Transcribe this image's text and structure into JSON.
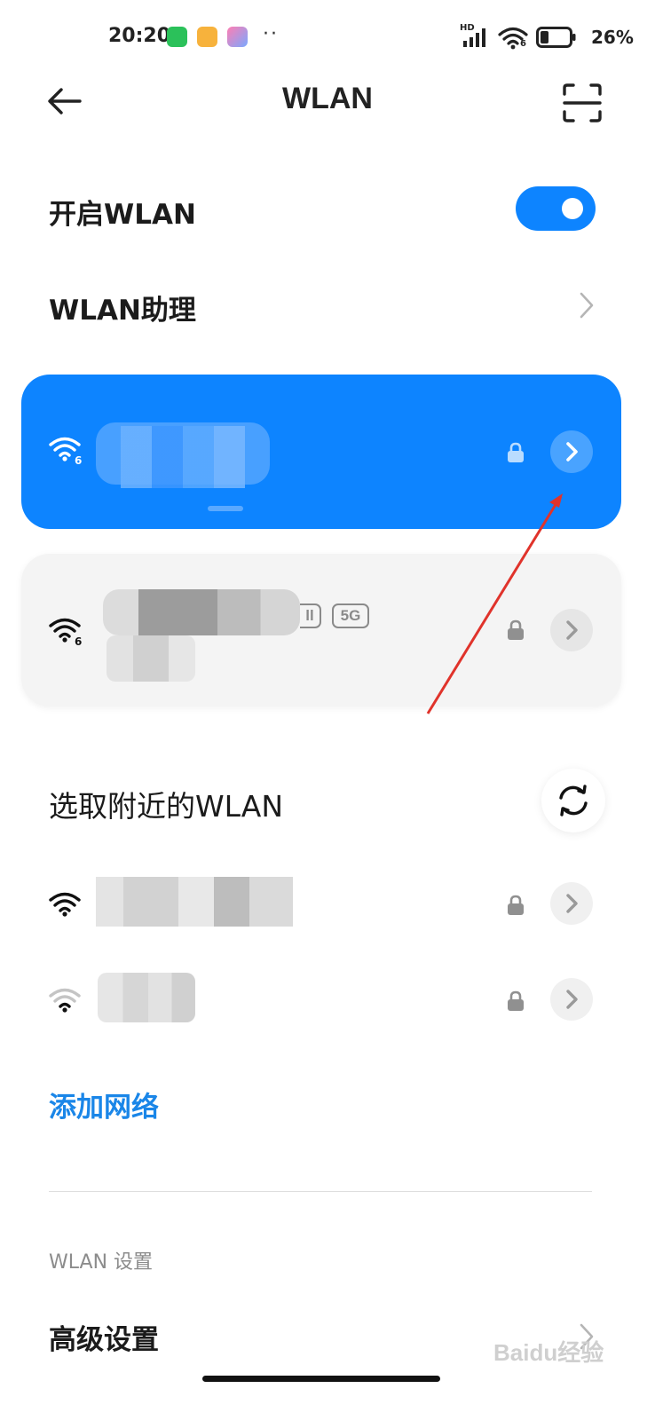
{
  "status_bar": {
    "time": "20:20",
    "dots": "··",
    "battery_percent": "26%",
    "wifi_generation": "6",
    "network_label": "HD"
  },
  "header": {
    "title": "WLAN",
    "back_icon": "arrow-left-icon",
    "scan_icon": "scan-frame-icon"
  },
  "wlan_toggle": {
    "label": "开启WLAN",
    "state": "on",
    "accent_color": "#0d84ff"
  },
  "assistant": {
    "label": "WLAN助理"
  },
  "connected_network": {
    "wifi_generation": "6",
    "secured": true
  },
  "saved_network": {
    "wifi_generation": "6",
    "band_tag": "5G",
    "secured": true
  },
  "nearby": {
    "title": "选取附近的WLAN",
    "networks": [
      {
        "secured": true,
        "signal": "strong"
      },
      {
        "secured": true,
        "signal": "weak"
      }
    ]
  },
  "add_network": {
    "label": "添加网络",
    "color": "#1a86e8"
  },
  "settings": {
    "caption": "WLAN 设置",
    "advanced_label": "高级设置"
  },
  "watermark": "Baidu经验"
}
